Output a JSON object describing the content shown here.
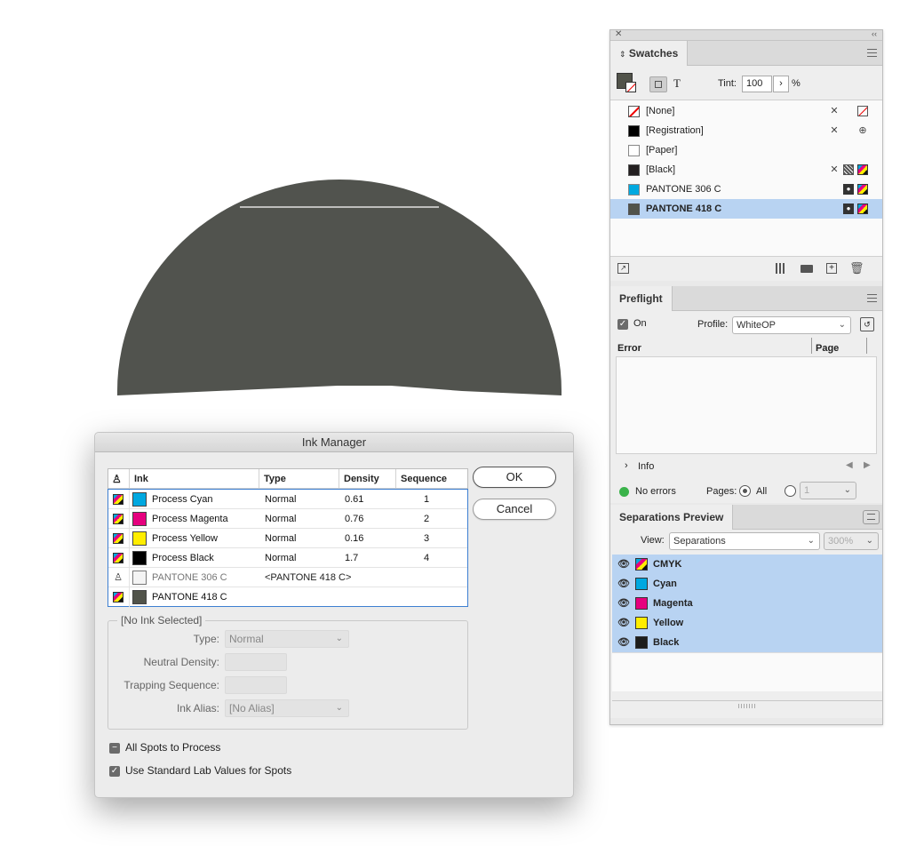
{
  "swatches_panel": {
    "tab": "Swatches",
    "tint_label": "Tint:",
    "tint_value": "100",
    "percent": "%",
    "text_glyph": "T",
    "items": [
      {
        "name": "[None]",
        "color": "none"
      },
      {
        "name": "[Registration]",
        "color": "#000000"
      },
      {
        "name": "[Paper]",
        "color": "#ffffff"
      },
      {
        "name": "[Black]",
        "color": "#231f20"
      },
      {
        "name": "PANTONE 306 C",
        "color": "#00a9e0"
      },
      {
        "name": "PANTONE 418 C",
        "color": "#51534a",
        "selected": true
      }
    ]
  },
  "preflight_panel": {
    "tab": "Preflight",
    "on_label": "On",
    "profile_label": "Profile:",
    "profile_value": "WhiteOP",
    "col_error": "Error",
    "col_page": "Page",
    "info_label": "Info",
    "status": "No errors",
    "status_color": "#3ab34a",
    "pages_label": "Pages:",
    "pages_all": "All",
    "pages_value": "1"
  },
  "separations_panel": {
    "tab": "Separations Preview",
    "view_label": "View:",
    "view_value": "Separations",
    "zoom": "300%",
    "rows": [
      {
        "name": "CMYK",
        "color": "cmyk"
      },
      {
        "name": "Cyan",
        "color": "#00a8e0"
      },
      {
        "name": "Magenta",
        "color": "#e6007e"
      },
      {
        "name": "Yellow",
        "color": "#ffed00"
      },
      {
        "name": "Black",
        "color": "#1d1d1b"
      }
    ]
  },
  "ink_manager": {
    "title": "Ink Manager",
    "headers": {
      "ink": "Ink",
      "type": "Type",
      "density": "Density",
      "sequence": "Sequence"
    },
    "inks": [
      {
        "name": "Process Cyan",
        "type": "Normal",
        "density": "0.61",
        "sequence": "1",
        "color": "#00a8e0",
        "icon": "process"
      },
      {
        "name": "Process Magenta",
        "type": "Normal",
        "density": "0.76",
        "sequence": "2",
        "color": "#e6007e",
        "icon": "process"
      },
      {
        "name": "Process Yellow",
        "type": "Normal",
        "density": "0.16",
        "sequence": "3",
        "color": "#ffed00",
        "icon": "process"
      },
      {
        "name": "Process Black",
        "type": "Normal",
        "density": "1.7",
        "sequence": "4",
        "color": "#000000",
        "icon": "process"
      },
      {
        "name": "PANTONE 306 C",
        "type": "<PANTONE 418 C>",
        "density": "",
        "sequence": "",
        "color": "#f4f4f4",
        "icon": "spot",
        "aliased": true
      },
      {
        "name": "PANTONE 418 C",
        "type": "",
        "density": "",
        "sequence": "",
        "color": "#51534a",
        "icon": "process"
      }
    ],
    "ok": "OK",
    "cancel": "Cancel",
    "group_title": "[No Ink Selected]",
    "type_label": "Type:",
    "type_value": "Normal",
    "nd_label": "Neutral Density:",
    "trap_label": "Trapping Sequence:",
    "alias_label": "Ink Alias:",
    "alias_value": "[No Alias]",
    "all_spots": "All Spots to Process",
    "use_lab": "Use Standard Lab Values for Spots"
  },
  "artwork": {
    "fill_color": "#51534e"
  }
}
